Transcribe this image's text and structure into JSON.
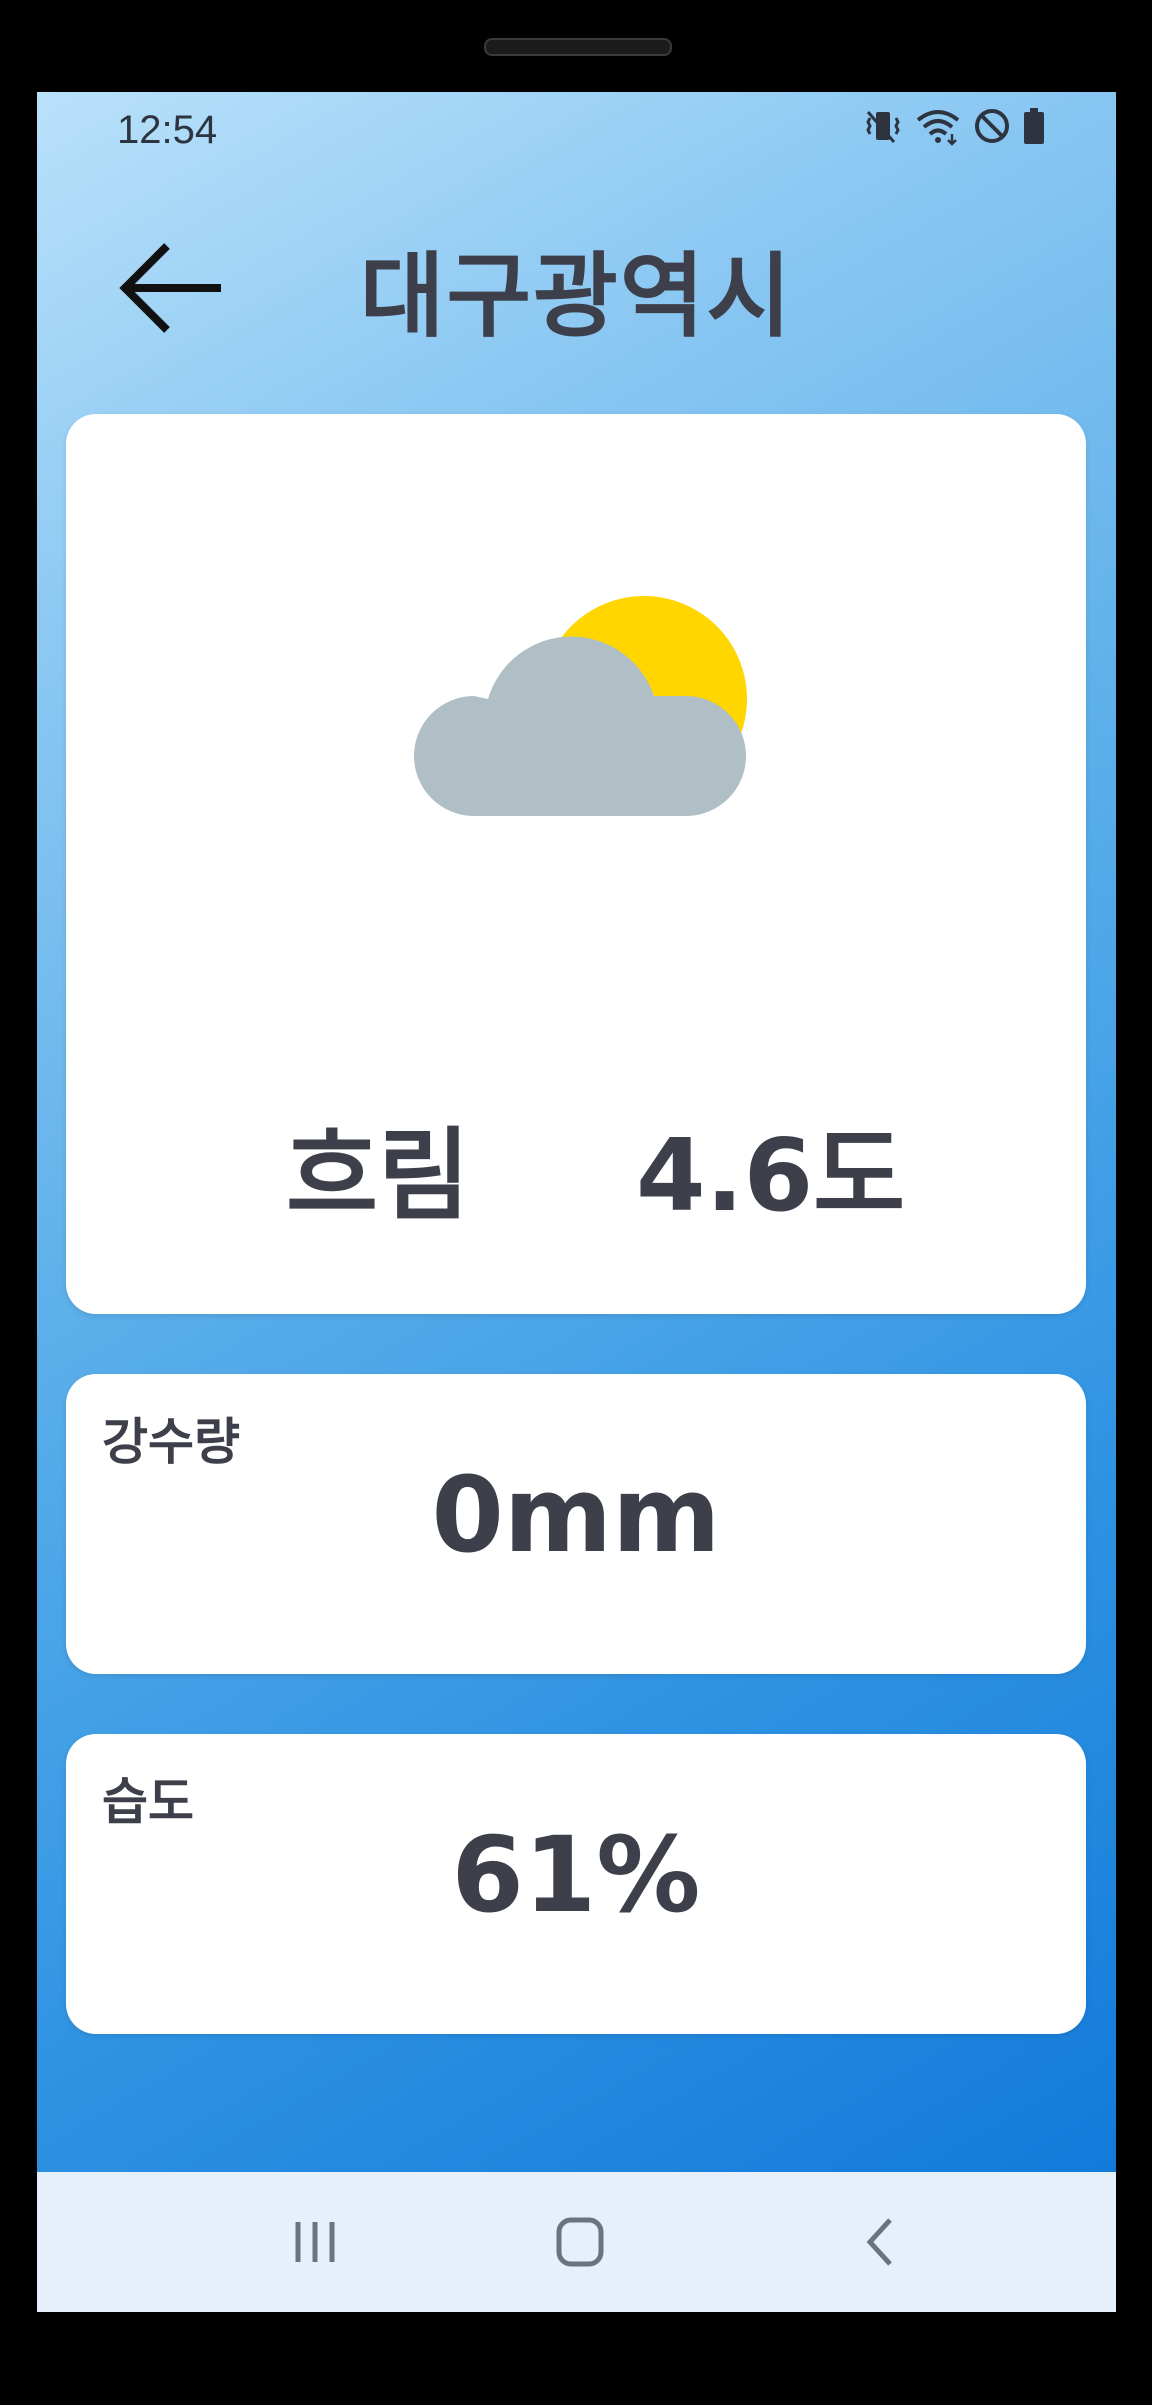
{
  "status_bar": {
    "time": "12:54",
    "icons": [
      "vibrate-icon",
      "wifi-icon",
      "do-not-disturb-icon",
      "battery-icon"
    ]
  },
  "header": {
    "back_icon": "arrow-left-icon",
    "title": "대구광역시"
  },
  "weather": {
    "icon": "partly-cloudy-icon",
    "condition": "흐림",
    "temperature": "4.6도",
    "colors": {
      "sun": "#FFD600",
      "cloud": "#B0BEC5"
    }
  },
  "rainfall": {
    "label": "강수량",
    "value": "0mm"
  },
  "humidity": {
    "label": "습도",
    "value": "61%"
  },
  "nav": {
    "icons": [
      "recents-icon",
      "home-icon",
      "back-chevron-icon"
    ]
  },
  "colors": {
    "text": "#3D3F4A",
    "card": "#FFFFFF",
    "gradient_top": "#B9E1FA",
    "gradient_bottom": "#0C76D8",
    "nav_bar": "#E6F0FA"
  }
}
